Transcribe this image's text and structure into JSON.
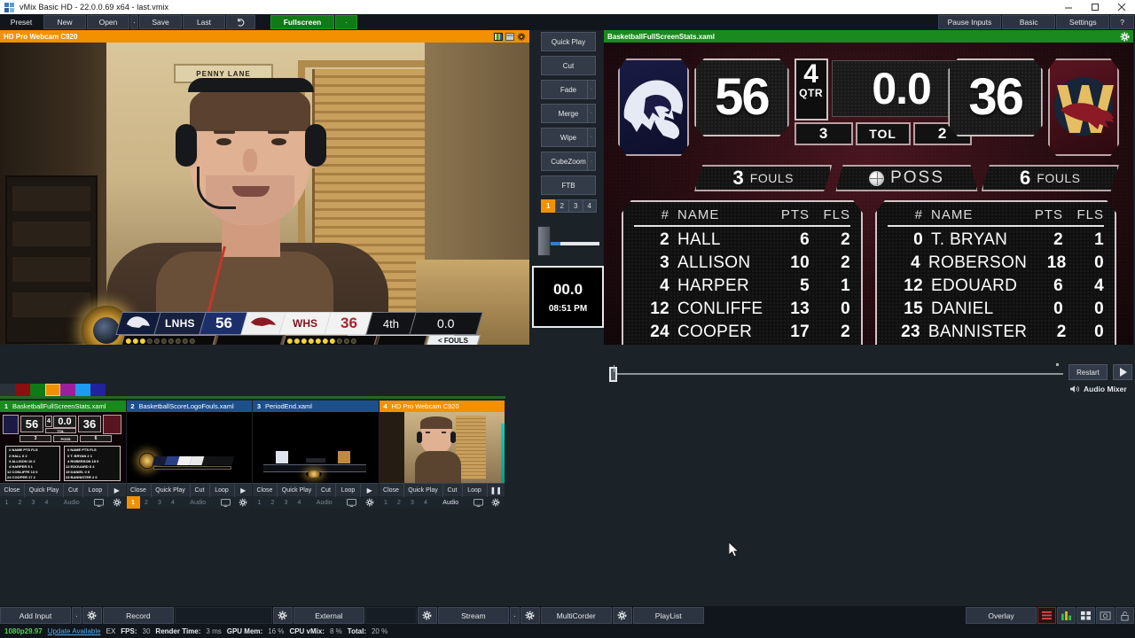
{
  "window": {
    "title": "vMix Basic HD - 22.0.0.69 x64 - last.vmix",
    "minimize": "minimize-icon",
    "maximize": "maximize-icon",
    "close": "close-icon"
  },
  "toolbar": {
    "preset_label": "Preset",
    "new_label": "New",
    "open_label": "Open",
    "open_arrow": "▾",
    "save_label": "Save",
    "last_label": "Last",
    "undo_icon": "↺",
    "fullscreen_label": "Fullscreen",
    "fullscreen_arrow": "▾",
    "pause_inputs_label": "Pause Inputs",
    "basic_label": "Basic",
    "settings_label": "Settings",
    "help_label": "?"
  },
  "preview": {
    "title": "HD Pro Webcam C920",
    "icons": [
      "color-bars-icon",
      "window-icon",
      "gear-icon"
    ],
    "sign_text": "PENNY LANE"
  },
  "lower_third": {
    "home_abbr": "LNHS",
    "home_score": "56",
    "away_abbr": "WHS",
    "away_score": "36",
    "period": "4th",
    "clock": "0.0",
    "fouls_label": "< FOULS",
    "home_bonus_on": 3,
    "home_bonus_total": 10,
    "away_bonus_on": 7,
    "away_bonus_total": 11
  },
  "transitions": {
    "buttons": [
      {
        "label": "Quick Play",
        "has_arrow": false
      },
      {
        "label": "Cut",
        "has_arrow": false
      },
      {
        "label": "Fade",
        "has_arrow": true
      },
      {
        "label": "Merge",
        "has_arrow": true
      },
      {
        "label": "Wipe",
        "has_arrow": true
      },
      {
        "label": "CubeZoom",
        "has_arrow": true
      },
      {
        "label": "FTB",
        "has_arrow": false
      }
    ],
    "numbers": [
      "1",
      "2",
      "3",
      "4"
    ],
    "active_number": "1",
    "arrow_glyph": "▾"
  },
  "clock_box": {
    "countdown": "00.0",
    "time_of_day": "08:51 PM"
  },
  "program": {
    "title": "BasketballFullScreenStats.xaml",
    "gear_icon": "gear-icon"
  },
  "scoreboard": {
    "home_logo": "lion-head-logo",
    "away_logo": "w-bronco-logo",
    "home_score": "56",
    "away_score": "36",
    "quarter_value": "4",
    "quarter_label": "QTR",
    "game_clock": "0.0",
    "home_timeouts": "3",
    "tol_label": "TOL",
    "away_timeouts": "2",
    "home_fouls_value": "3",
    "fouls_label": "FOULS",
    "poss_label": "POSS",
    "poss_icon": "basketball-icon",
    "away_fouls_value": "6"
  },
  "stats": {
    "headers": {
      "num": "#",
      "name": "NAME",
      "pts": "PTS",
      "fls": "FLS"
    },
    "home_players": [
      {
        "num": "2",
        "name": "HALL",
        "pts": "6",
        "fls": "2"
      },
      {
        "num": "3",
        "name": "ALLISON",
        "pts": "10",
        "fls": "2"
      },
      {
        "num": "4",
        "name": "HARPER",
        "pts": "5",
        "fls": "1"
      },
      {
        "num": "12",
        "name": "CONLIFFE",
        "pts": "13",
        "fls": "0"
      },
      {
        "num": "24",
        "name": "COOPER",
        "pts": "17",
        "fls": "2"
      }
    ],
    "away_players": [
      {
        "num": "0",
        "name": "T. BRYAN",
        "pts": "2",
        "fls": "1"
      },
      {
        "num": "4",
        "name": "ROBERSON",
        "pts": "18",
        "fls": "0"
      },
      {
        "num": "12",
        "name": "EDOUARD",
        "pts": "6",
        "fls": "4"
      },
      {
        "num": "15",
        "name": "DANIEL",
        "pts": "0",
        "fls": "0"
      },
      {
        "num": "23",
        "name": "BANNISTER",
        "pts": "2",
        "fls": "0"
      }
    ]
  },
  "playback": {
    "restart_label": "Restart",
    "play_icon": "play-icon",
    "audio_mixer_label": "Audio Mixer",
    "speaker_icon": "speaker-icon"
  },
  "swatches": [
    "#2a333c",
    "#8b0f0f",
    "#0f7a16",
    "#f39000",
    "#9c1f9c",
    "#1d9bf0",
    "#22229c"
  ],
  "inputs": [
    {
      "index": "1",
      "title": "BasketballFullScreenStats.xaml",
      "header_color": "green",
      "close": "Close",
      "quick_play": "Quick Play",
      "cut": "Cut",
      "loop": "Loop",
      "play_icon": "play-icon",
      "numbers": [
        "1",
        "2",
        "3",
        "4"
      ],
      "active_number": null,
      "audio_label": "Audio",
      "monitor_icon": "monitor-icon",
      "gear_icon": "gear-icon"
    },
    {
      "index": "2",
      "title": "BasketballScoreLogoFouls.xaml",
      "header_color": "blue",
      "close": "Close",
      "quick_play": "Quick Play",
      "cut": "Cut",
      "loop": "Loop",
      "play_icon": "play-icon",
      "numbers": [
        "1",
        "2",
        "3",
        "4"
      ],
      "active_number": "1",
      "audio_label": "Audio",
      "monitor_icon": "monitor-icon",
      "gear_icon": "gear-icon"
    },
    {
      "index": "3",
      "title": "PeriodEnd.xaml",
      "header_color": "blue",
      "close": "Close",
      "quick_play": "Quick Play",
      "cut": "Cut",
      "loop": "Loop",
      "play_icon": "play-icon",
      "numbers": [
        "1",
        "2",
        "3",
        "4"
      ],
      "active_number": null,
      "audio_label": "Audio",
      "monitor_icon": "monitor-icon",
      "gear_icon": "gear-icon"
    },
    {
      "index": "4",
      "title": "HD Pro Webcam C920",
      "header_color": "orange",
      "close": "Close",
      "quick_play": "Quick Play",
      "cut": "Cut",
      "loop": "Loop",
      "play_icon": "pause-icon",
      "numbers": [
        "1",
        "2",
        "3",
        "4"
      ],
      "active_number": null,
      "audio_label": "Audio",
      "monitor_icon": "monitor-icon",
      "gear_icon": "gear-icon"
    }
  ],
  "bottom_bar": {
    "add_input": "Add Input",
    "add_input_arrow": "▾",
    "record": "Record",
    "external": "External",
    "stream": "Stream",
    "stream_arrow": "▾",
    "multicorder": "MultiCorder",
    "playlist": "PlayList",
    "gear_icon": "gear-icon",
    "overlay": "Overlay",
    "right_icons": [
      "list-icon",
      "bars-icon",
      "grid-icon",
      "snapshot-icon",
      "lock-icon"
    ]
  },
  "status_bar": {
    "resolution": "1080p29.97",
    "update": "Update Available",
    "ex": "EX",
    "fps_label": "FPS:",
    "fps_value": "30",
    "render_label": "Render Time:",
    "render_value": "3 ms",
    "gpu_label": "GPU Mem:",
    "gpu_value": "16 %",
    "cpu_label": "CPU vMix:",
    "cpu_value": "8 %",
    "total_label": "Total:",
    "total_value": "20 %"
  }
}
